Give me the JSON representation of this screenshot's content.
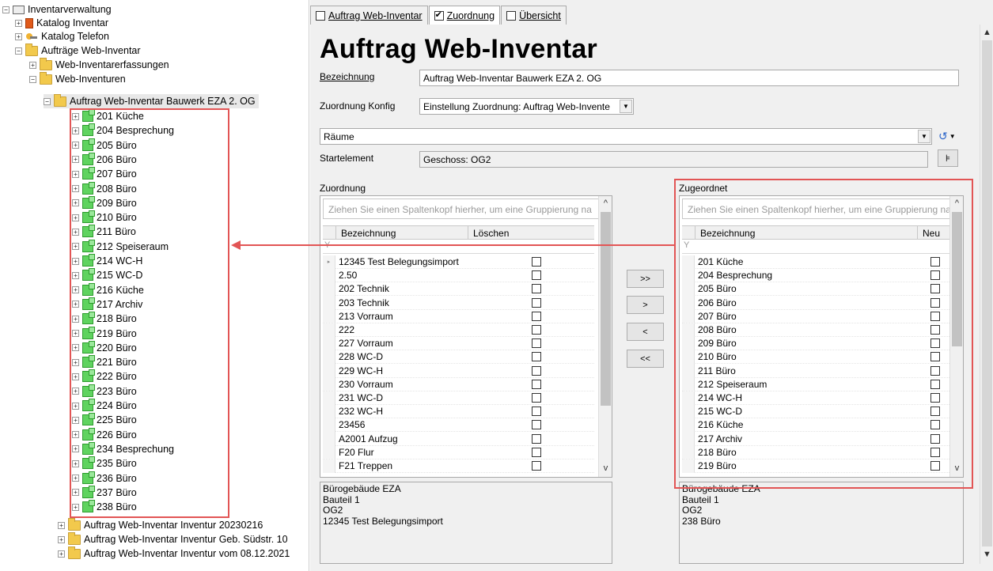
{
  "tree": {
    "root": "Inventarverwaltung",
    "catalogs": [
      "Katalog Inventar",
      "Katalog Telefon"
    ],
    "orders_folder": "Aufträge Web-Inventar",
    "sub_folders": [
      "Web-Inventarerfassungen",
      "Web-Inventuren"
    ],
    "selected_order": "Auftrag Web-Inventar Bauwerk EZA 2. OG",
    "rooms": [
      "201 Küche",
      "204 Besprechung",
      "205 Büro",
      "206 Büro",
      "207 Büro",
      "208 Büro",
      "209 Büro",
      "210 Büro",
      "211 Büro",
      "212 Speiseraum",
      "214 WC-H",
      "215 WC-D",
      "216 Küche",
      "217 Archiv",
      "218 Büro",
      "219 Büro",
      "220 Büro",
      "221 Büro",
      "222 Büro",
      "223 Büro",
      "224 Büro",
      "225 Büro",
      "226 Büro",
      "234 Besprechung",
      "235 Büro",
      "236 Büro",
      "237 Büro",
      "238 Büro"
    ],
    "other_orders": [
      "Auftrag Web-Inventar Inventur 20230216",
      "Auftrag Web-Inventar Inventur Geb. Südstr. 10",
      "Auftrag Web-Inventar Inventur vom 08.12.2021"
    ]
  },
  "tabs": [
    {
      "label": "Auftrag Web-Inventar",
      "checked": false
    },
    {
      "label": "Zuordnung",
      "checked": true
    },
    {
      "label": "Übersicht",
      "checked": false
    }
  ],
  "form": {
    "title": "Auftrag Web-Inventar",
    "bezeichnung_label": "Bezeichnung",
    "bezeichnung_value": "Auftrag Web-Inventar Bauwerk EZA 2. OG",
    "konfig_label": "Zuordnung Konfig",
    "konfig_value": "Einstellung Zuordnung: Auftrag Web-Invente",
    "type_value": "Räume",
    "start_label": "Startelement",
    "start_value": "Geschoss: OG2"
  },
  "left_grid": {
    "label": "Zuordnung",
    "group_hint": "Ziehen Sie einen Spaltenkopf hierher, um eine Gruppierung na",
    "col1": "Bezeichnung",
    "col2": "Löschen",
    "rows": [
      "12345 Test Belegungsimport",
      "2.50",
      "202 Technik",
      "203 Technik",
      "213 Vorraum",
      "222",
      "227 Vorraum",
      "228 WC-D",
      "229 WC-H",
      "230 Vorraum",
      "231 WC-D",
      "232 WC-H",
      "23456",
      "A2001 Aufzug",
      "F20 Flur",
      "F21 Treppen"
    ],
    "info": [
      "Bürogebäude EZA",
      "Bauteil 1",
      "OG2",
      "12345 Test Belegungsimport"
    ]
  },
  "right_grid": {
    "label": "Zugeordnet",
    "group_hint": "Ziehen Sie einen Spaltenkopf hierher, um eine Gruppierung na",
    "col1": "Bezeichnung",
    "col2": "Neu",
    "rows": [
      "201 Küche",
      "204 Besprechung",
      "205 Büro",
      "206 Büro",
      "207 Büro",
      "208 Büro",
      "209 Büro",
      "210 Büro",
      "211 Büro",
      "212 Speiseraum",
      "214 WC-H",
      "215 WC-D",
      "216 Küche",
      "217 Archiv",
      "218 Büro",
      "219 Büro"
    ],
    "info": [
      "Bürogebäude EZA",
      "Bauteil 1",
      "OG2",
      "238 Büro"
    ]
  },
  "buttons": {
    "all_right": ">>",
    "right": ">",
    "left": "<",
    "all_left": "<<"
  },
  "colors": {
    "highlight": "#e25555",
    "room_icon": "#5fd35f",
    "folder_icon": "#f2c94c"
  }
}
